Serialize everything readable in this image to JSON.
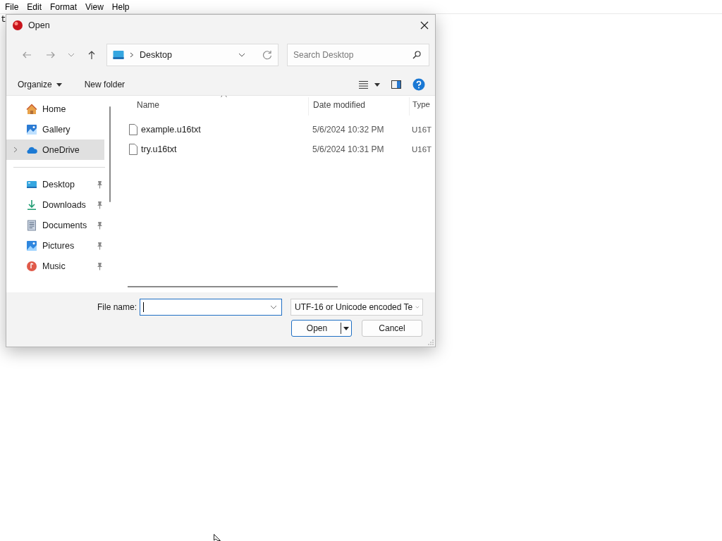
{
  "menu": [
    {
      "label": "File"
    },
    {
      "label": "Edit"
    },
    {
      "label": "Format"
    },
    {
      "label": "View"
    },
    {
      "label": "Help"
    }
  ],
  "editor_text": "t",
  "dialog": {
    "title": "Open",
    "address": {
      "path": "Desktop"
    },
    "search": {
      "placeholder": "Search Desktop"
    },
    "toolbar": {
      "organize": "Organize",
      "new_folder": "New folder"
    },
    "nav_pane": {
      "groups": [
        {
          "items": [
            {
              "label": "Home",
              "kind": "home",
              "selected": false,
              "pinned": false,
              "expandable": false
            },
            {
              "label": "Gallery",
              "kind": "gallery",
              "selected": false,
              "pinned": false,
              "expandable": false
            },
            {
              "label": "OneDrive",
              "kind": "cloud",
              "selected": true,
              "pinned": false,
              "expandable": true
            }
          ]
        },
        {
          "items": [
            {
              "label": "Desktop",
              "kind": "desktop",
              "selected": false,
              "pinned": true,
              "expandable": false
            },
            {
              "label": "Downloads",
              "kind": "downloads",
              "selected": false,
              "pinned": true,
              "expandable": false
            },
            {
              "label": "Documents",
              "kind": "documents",
              "selected": false,
              "pinned": true,
              "expandable": false
            },
            {
              "label": "Pictures",
              "kind": "pictures",
              "selected": false,
              "pinned": true,
              "expandable": false
            },
            {
              "label": "Music",
              "kind": "music",
              "selected": false,
              "pinned": true,
              "expandable": false
            }
          ]
        }
      ]
    },
    "columns": [
      {
        "label": "Name",
        "sorted": true
      },
      {
        "label": "Date modified",
        "sorted": false
      },
      {
        "label": "Type",
        "sorted": false
      }
    ],
    "files": [
      {
        "name": "example.u16txt",
        "date_modified": "5/6/2024 10:32 PM",
        "type": "U16T"
      },
      {
        "name": "try.u16txt",
        "date_modified": "5/6/2024 10:31 PM",
        "type": "U16T"
      }
    ],
    "file_name_label": "File name:",
    "file_type": "UTF-16 or Unicode encoded Te",
    "buttons": [
      {
        "label": "Open",
        "kind": "split",
        "default": true
      },
      {
        "label": "Cancel",
        "kind": "plain",
        "default": false
      }
    ]
  }
}
